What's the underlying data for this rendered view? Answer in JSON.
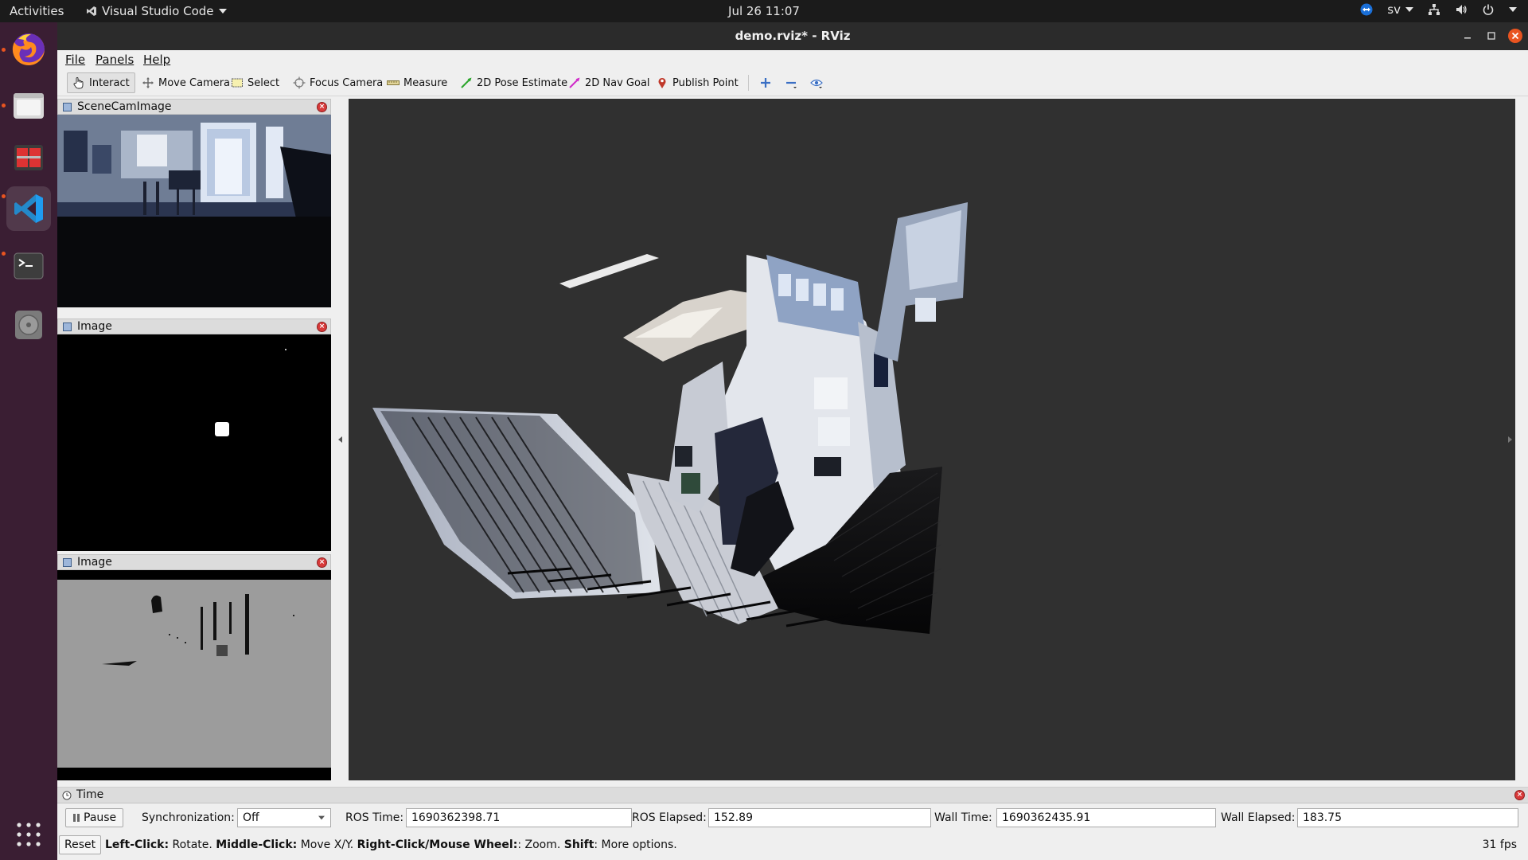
{
  "topbar": {
    "activities": "Activities",
    "app_menu": "Visual Studio Code",
    "clock": "Jul 26  11:07",
    "keyboard_layout": "sv"
  },
  "dock": {
    "items": [
      "firefox-icon",
      "files-icon",
      "app-grid-red-icon",
      "vscode-icon",
      "terminal-icon",
      "disk-icon",
      "show-apps-icon"
    ]
  },
  "window": {
    "title": "demo.rviz* - RViz"
  },
  "menu": {
    "file": "File",
    "panels": "Panels",
    "help": "Help"
  },
  "toolbar": {
    "interact": "Interact",
    "move_camera": "Move Camera",
    "select": "Select",
    "focus_camera": "Focus Camera",
    "measure": "Measure",
    "pose_estimate": "2D Pose Estimate",
    "nav_goal": "2D Nav Goal",
    "publish_point": "Publish Point"
  },
  "panels": {
    "scene_cam": "SceneCamImage",
    "image1": "Image",
    "image2": "Image"
  },
  "time": {
    "title": "Time",
    "pause": "Pause",
    "sync_label": "Synchronization:",
    "sync_value": "Off",
    "ros_time_label": "ROS Time:",
    "ros_time": "1690362398.71",
    "ros_elapsed_label": "ROS Elapsed:",
    "ros_elapsed": "152.89",
    "wall_time_label": "Wall Time:",
    "wall_time": "1690362435.91",
    "wall_elapsed_label": "Wall Elapsed:",
    "wall_elapsed": "183.75"
  },
  "status": {
    "reset": "Reset",
    "left_click": "Left-Click:",
    "left_action": " Rotate. ",
    "middle_click": "Middle-Click:",
    "middle_action": " Move X/Y. ",
    "right_click": "Right-Click/Mouse Wheel:",
    "right_action": ": Zoom. ",
    "shift": "Shift",
    "shift_action": ": More options.",
    "fps": "31 fps"
  },
  "colors": {
    "dock_bg": "#3a1e33",
    "accent": "#e95420",
    "view_bg": "#303030"
  }
}
